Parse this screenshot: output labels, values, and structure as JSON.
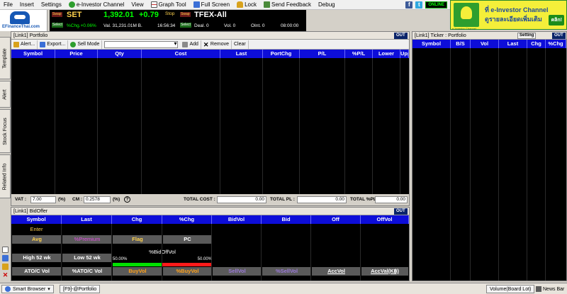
{
  "menu": {
    "items": [
      {
        "label": "File",
        "icon": "none"
      },
      {
        "label": "Insert",
        "icon": "none"
      },
      {
        "label": "Settings",
        "icon": "none"
      },
      {
        "label": "e-Investor Channel",
        "icon": "e-investor-icon"
      },
      {
        "label": "View",
        "icon": "none"
      },
      {
        "label": "Graph Tool",
        "icon": "graph-icon"
      },
      {
        "label": "Full Screen",
        "icon": "fullscreen-icon"
      },
      {
        "label": "Lock",
        "icon": "lock-icon"
      },
      {
        "label": "Send Feedback",
        "icon": "feedback-icon"
      },
      {
        "label": "Debug",
        "icon": "none"
      }
    ],
    "online": "ONLINE"
  },
  "ad": {
    "line1": "ที่ e-Investor Channel",
    "line2": "ดูรายละเอียดเพิ่มเติม",
    "button": "คลิก!",
    "logo_caption": "e-Investor Channel"
  },
  "logo": {
    "text": "EFinanceThai.com"
  },
  "ticker": {
    "swap1": "Swap",
    "select1": "Select",
    "index_name": "SET",
    "index_value": "1,392.01",
    "index_change": "+0.79",
    "pct_change": "%Chg.+0.06%",
    "volume": "Val. 31,231.01M B.",
    "time": "16:56:34",
    "stop": "Stop",
    "swap2": "Swap",
    "select2": "Select",
    "deriv_name": "TFEX-All",
    "deal": "Deal. 0",
    "vol": "Vol. 0",
    "oint": "OInt. 0",
    "deriv_time": "08:00:00"
  },
  "side_tabs": [
    "Template",
    "Alert",
    "Stock Focus",
    "Related Info"
  ],
  "portfolio": {
    "title": "[Link1] Portfolio",
    "out": "OUT",
    "toolbar": {
      "alert": "Alert...",
      "export": "Export...",
      "sell_mode": "Sell Mode",
      "add": "Add",
      "remove": "Remove",
      "clear": "Clear"
    },
    "columns": [
      "Symbol",
      "Price",
      "Qty",
      "Cost",
      "Last",
      "PortChg",
      "P/L",
      "%P/L",
      "Lower",
      "Upper"
    ],
    "footer": {
      "vat_label": "VAT :",
      "vat_value": "7.00",
      "vat_unit": "(%)",
      "cm_label": "CM :",
      "cm_value": "0.2578",
      "cm_unit": "(%)",
      "help": "?",
      "total_cost_label": "TOTAL COST :",
      "total_cost_value": "0.00",
      "total_pl_label": "TOTAL PL :",
      "total_pl_value": "0.00",
      "total_pct_pl_label": "TOTAL %PL :",
      "total_pct_pl_value": "0.00"
    }
  },
  "ticker_panel": {
    "title": "[Link1] Ticker : Portfolio",
    "setting": "Setting",
    "out": "OUT",
    "columns": [
      "Symbol",
      "B/S",
      "Vol",
      "Last",
      "Chg",
      "%Chg"
    ]
  },
  "bidoffer": {
    "title": "[Link1] BidOffer",
    "out": "OUT",
    "columns": [
      "Symbol",
      "Last",
      "Chg",
      "%Chg",
      "BidVol",
      "Bid",
      "Off",
      "OffVol"
    ],
    "enter": "Enter",
    "row_avg": [
      "Avg",
      "%Premium",
      "Flag",
      "PC"
    ],
    "row_high": [
      "High 52 wk",
      "Low 52 wk"
    ],
    "bidoff_label": "%BidOffVol",
    "bid_pct": "50.00%",
    "off_pct": "50.00%",
    "bid_fraction": 0.5,
    "bottom_row": [
      "ATO/C Vol",
      "%ATO/C Vol",
      "BuyVol",
      "%BuyVol",
      "SellVol",
      "%SellVol",
      "AccVol",
      "AccVal(K฿)"
    ]
  },
  "status": {
    "smart_browser": "Smart Browser",
    "tab": "[F9]-@Portfolio",
    "volume_mode": "Volume(Board Lot)",
    "news_bar": "News Bar"
  },
  "colors": {
    "header_blue": "#0d0dd9",
    "up_green": "#00ff00",
    "bid_bar": "#00e000",
    "off_bar": "#ff1a1a"
  }
}
